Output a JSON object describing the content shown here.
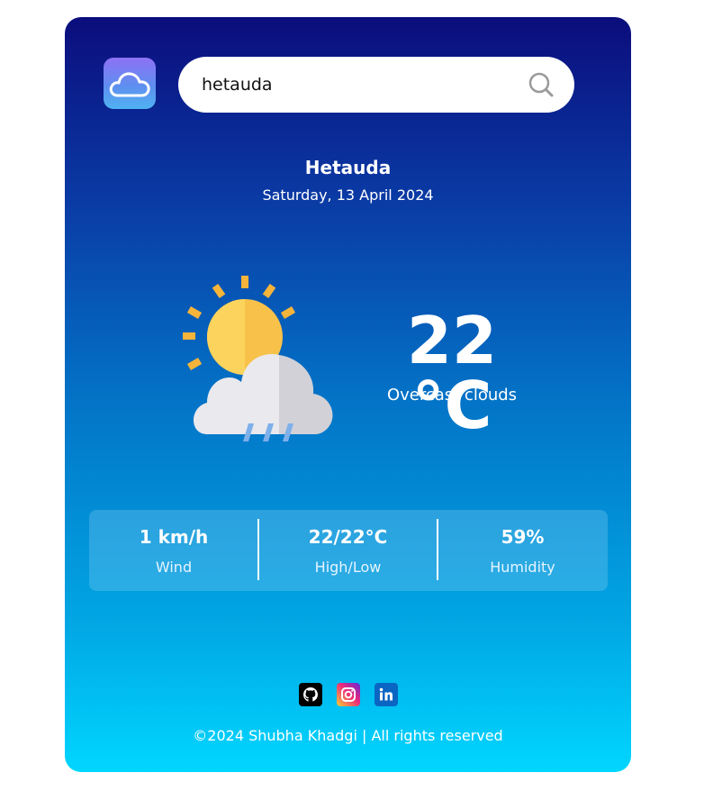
{
  "search": {
    "value": "hetauda",
    "placeholder": ""
  },
  "location": {
    "city": "Hetauda",
    "date": "Saturday, 13 April 2024"
  },
  "current": {
    "temperature": "22 °C",
    "description": "Overcast clouds",
    "icon": "sun-cloud-rain-icon"
  },
  "stats": [
    {
      "value": "1 km/h",
      "label": "Wind"
    },
    {
      "value": "22/22°C",
      "label": "High/Low"
    },
    {
      "value": "59%",
      "label": "Humidity"
    }
  ],
  "social": [
    {
      "icon": "github-icon",
      "color": "#000000"
    },
    {
      "icon": "instagram-icon",
      "color": "#ee2a7b"
    },
    {
      "icon": "linkedin-icon",
      "color": "#0a66c2"
    }
  ],
  "footer": {
    "text": "©2024 Shubha Khadgi | All rights reserved"
  },
  "colors": {
    "gradient_top": "#0b0d7c",
    "gradient_bottom": "#00d6ff"
  }
}
